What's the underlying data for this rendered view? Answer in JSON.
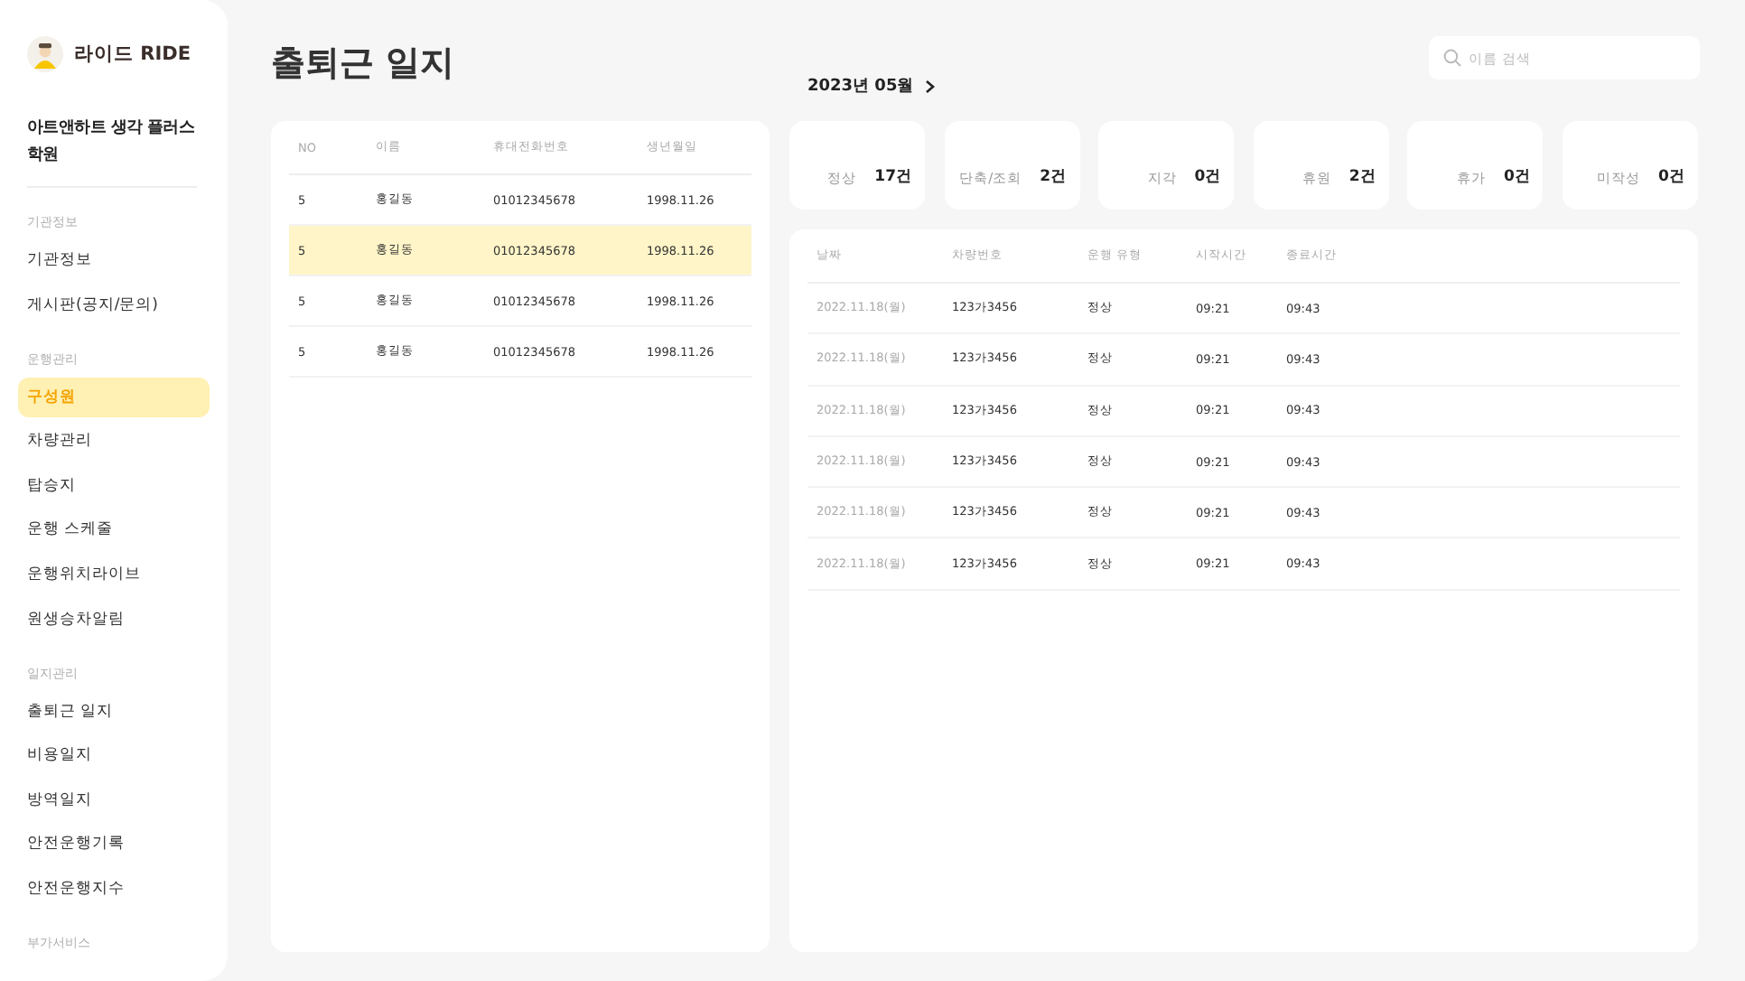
{
  "brand": {
    "name": "라이드 RIDE"
  },
  "sidebar": {
    "org": "아트앤하트 생각 플러스 학원",
    "sections": [
      {
        "label": "기관정보",
        "items": [
          {
            "label": "기관정보",
            "selected": false
          },
          {
            "label": "게시판(공지/문의)",
            "selected": false
          }
        ]
      },
      {
        "label": "운행관리",
        "items": [
          {
            "label": "구성원",
            "selected": true
          },
          {
            "label": "차량관리",
            "selected": false
          },
          {
            "label": "탑승지",
            "selected": false
          },
          {
            "label": "운행 스케줄",
            "selected": false
          },
          {
            "label": "운행위치라이브",
            "selected": false
          },
          {
            "label": "원생승차알림",
            "selected": false
          }
        ]
      },
      {
        "label": "일지관리",
        "items": [
          {
            "label": "출퇴근 일지",
            "selected": false
          },
          {
            "label": "비용일지",
            "selected": false
          },
          {
            "label": "방역일지",
            "selected": false
          },
          {
            "label": "안전운행기록",
            "selected": false
          },
          {
            "label": "안전운행지수",
            "selected": false
          }
        ]
      },
      {
        "label": "부가서비스"
      }
    ]
  },
  "page": {
    "title": "출퇴근 일지",
    "month": "2023년 05월",
    "search": {
      "placeholder": "이름 검색"
    }
  },
  "members": {
    "columns": [
      "NO",
      "이름",
      "휴대전화번호",
      "생년월일"
    ],
    "rows": [
      {
        "cells": [
          "5",
          "홍길동",
          "01012345678",
          "1998.11.26"
        ],
        "selected": false
      },
      {
        "cells": [
          "5",
          "홍길동",
          "01012345678",
          "1998.11.26"
        ],
        "selected": true
      },
      {
        "cells": [
          "5",
          "홍길동",
          "01012345678",
          "1998.11.26"
        ],
        "selected": false
      },
      {
        "cells": [
          "5",
          "홍길동",
          "01012345678",
          "1998.11.26"
        ],
        "selected": false
      }
    ]
  },
  "stats": [
    {
      "label": "정상",
      "value": "17건"
    },
    {
      "label": "단축/조회",
      "value": "2건"
    },
    {
      "label": "지각",
      "value": "0건"
    },
    {
      "label": "휴원",
      "value": "2건"
    },
    {
      "label": "휴가",
      "value": "0건"
    },
    {
      "label": "미작성",
      "value": "0건"
    }
  ],
  "logs": {
    "columns": [
      "날짜",
      "차량번호",
      "운행 유형",
      "시작시간",
      "종료시간"
    ],
    "rows": [
      [
        "2022.11.18(월)",
        "123가3456",
        "정상",
        "09:21",
        "09:43"
      ],
      [
        "2022.11.18(월)",
        "123가3456",
        "정상",
        "09:21",
        "09:43"
      ],
      [
        "2022.11.18(월)",
        "123가3456",
        "정상",
        "09:21",
        "09:43"
      ],
      [
        "2022.11.18(월)",
        "123가3456",
        "정상",
        "09:21",
        "09:43"
      ],
      [
        "2022.11.18(월)",
        "123가3456",
        "정상",
        "09:21",
        "09:43"
      ],
      [
        "2022.11.18(월)",
        "123가3456",
        "정상",
        "09:21",
        "09:43"
      ]
    ]
  }
}
